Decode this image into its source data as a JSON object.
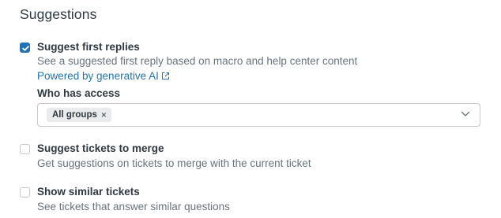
{
  "section": {
    "title": "Suggestions"
  },
  "options": [
    {
      "label": "Suggest first replies",
      "description": "See a suggested first reply based on macro and help center content",
      "link": "Powered by generative AI",
      "checked": true
    },
    {
      "label": "Suggest tickets to merge",
      "description": "Get suggestions on tickets to merge with the current ticket",
      "checked": false
    },
    {
      "label": "Show similar tickets",
      "description": "See tickets that answer similar questions",
      "checked": false
    }
  ],
  "access": {
    "label": "Who has access",
    "selected_tag": "All groups",
    "tag_close": "×"
  },
  "colors": {
    "accent": "#1f73b7",
    "text": "#2f3941",
    "muted": "#68737d",
    "border": "#c2c8cc"
  },
  "icons": {
    "checkbox_checked": "check-icon",
    "external_link": "external-link-icon",
    "dropdown": "chevron-down-icon"
  }
}
